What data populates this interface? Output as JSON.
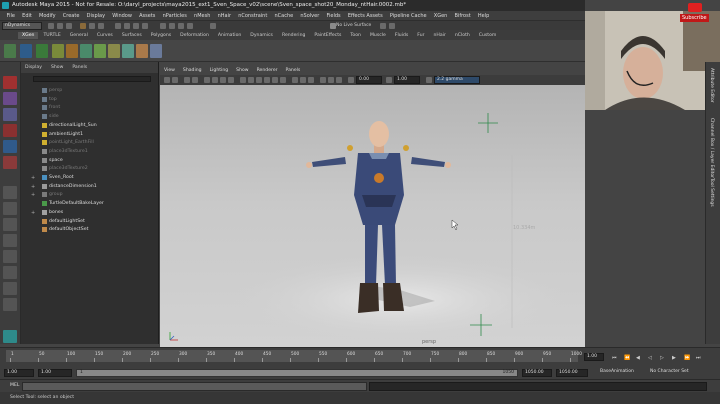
{
  "window": {
    "title": "Autodesk Maya 2015 - Not for Resale: O:\\daryl_projects\\maya2015_ext1_Sven_Space_v02\\scene\\Sven_space_shot20_Monday_ntHair.0002.mb*"
  },
  "menus": [
    "File",
    "Edit",
    "Modify",
    "Create",
    "Display",
    "Window",
    "Assets",
    "nParticles",
    "nMesh",
    "nHair",
    "nConstraint",
    "nCache",
    "nSolver",
    "Fields",
    "Effects Assets",
    "Pipeline Cache",
    "XGen",
    "Bifrost",
    "Help"
  ],
  "status": {
    "mode": "nDynamics",
    "live_surface": "No Live Surface"
  },
  "shelf_tabs": [
    {
      "label": "XGen",
      "active": true
    },
    {
      "label": "TURTLE",
      "active": false
    },
    {
      "label": "General",
      "active": false
    },
    {
      "label": "Curves",
      "active": false
    },
    {
      "label": "Surfaces",
      "active": false
    },
    {
      "label": "Polygons",
      "active": false
    },
    {
      "label": "Deformation",
      "active": false
    },
    {
      "label": "Animation",
      "active": false
    },
    {
      "label": "Dynamics",
      "active": false
    },
    {
      "label": "Rendering",
      "active": false
    },
    {
      "label": "PaintEffects",
      "active": false
    },
    {
      "label": "Toon",
      "active": false
    },
    {
      "label": "Muscle",
      "active": false
    },
    {
      "label": "Fluids",
      "active": false
    },
    {
      "label": "Fur",
      "active": false
    },
    {
      "label": "nHair",
      "active": false
    },
    {
      "label": "nCloth",
      "active": false
    },
    {
      "label": "Custom",
      "active": false
    }
  ],
  "outliner": {
    "menus": [
      "Display",
      "Show",
      "Panels"
    ],
    "items": [
      {
        "label": "persp",
        "dim": true,
        "expand": ""
      },
      {
        "label": "top",
        "dim": true,
        "expand": ""
      },
      {
        "label": "front",
        "dim": true,
        "expand": ""
      },
      {
        "label": "side",
        "dim": true,
        "expand": ""
      },
      {
        "label": "directionalLight_Sun",
        "dim": false,
        "expand": ""
      },
      {
        "label": "ambientLight1",
        "dim": false,
        "expand": ""
      },
      {
        "label": "pointLight_EarthFill",
        "dim": true,
        "expand": ""
      },
      {
        "label": "place3dTexture1",
        "dim": true,
        "expand": ""
      },
      {
        "label": "space",
        "dim": false,
        "expand": ""
      },
      {
        "label": "place3dTexture2",
        "dim": true,
        "expand": ""
      },
      {
        "label": "Sven_Root",
        "dim": false,
        "expand": "+"
      },
      {
        "label": "distanceDimension1",
        "dim": false,
        "expand": "+"
      },
      {
        "label": "group",
        "dim": true,
        "expand": "+"
      },
      {
        "label": "TurtleDefaultBakeLayer",
        "dim": false,
        "expand": ""
      },
      {
        "label": "bones",
        "dim": false,
        "expand": "+"
      },
      {
        "label": "defaultLightSet",
        "dim": false,
        "expand": ""
      },
      {
        "label": "defaultObjectSet",
        "dim": false,
        "expand": ""
      }
    ]
  },
  "viewport": {
    "menus": [
      "View",
      "Shading",
      "Lighting",
      "Show",
      "Renderer",
      "Panels"
    ],
    "field_a": "0.00",
    "field_b": "1.00",
    "color_space": "2.2 gamma",
    "camera_label": "persp",
    "dimension_label": "10.334m"
  },
  "right_tabs": [
    "Attribute Editor",
    "Channel Box / Layer Editor",
    "Tool Settings"
  ],
  "timeline": {
    "ticks": [
      "1",
      "50",
      "100",
      "150",
      "200",
      "250",
      "300",
      "350",
      "400",
      "450",
      "500",
      "550",
      "600",
      "650",
      "700",
      "750",
      "800",
      "850",
      "900",
      "950",
      "1000"
    ],
    "current_frame": "1.00"
  },
  "range": {
    "start": "1.00",
    "inner_start": "1.00",
    "marker": "1",
    "inner_end": "1050",
    "end_a": "1050.00",
    "end_b": "1050.00",
    "anim_layer": "BaseAnimation",
    "character_set": "No Character Set"
  },
  "command_line": {
    "label": "MEL"
  },
  "help_line": "Select Tool: select an object",
  "youtube": {
    "subscribe": "Subscribe"
  }
}
